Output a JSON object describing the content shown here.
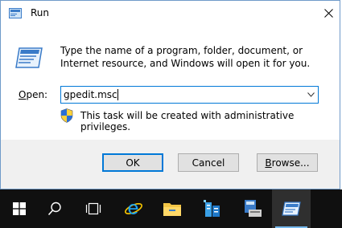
{
  "window": {
    "title": "Run",
    "description": "Type the name of a program, folder, document, or Internet resource, and Windows will open it for you.",
    "open_label_prefix": "",
    "open_label_accel": "O",
    "open_label_rest": "pen:",
    "open_value": "gpedit.msc",
    "admin_note": "This task will be created with administrative privileges."
  },
  "buttons": {
    "ok": "OK",
    "cancel": "Cancel",
    "browse_prefix": "",
    "browse_accel": "B",
    "browse_rest": "rowse..."
  },
  "taskbar": {
    "items": [
      {
        "icon": "windows-start-icon"
      },
      {
        "icon": "search-icon"
      },
      {
        "icon": "task-view-icon"
      },
      {
        "icon": "internet-explorer-icon"
      },
      {
        "icon": "file-explorer-icon"
      },
      {
        "icon": "server-manager-icon"
      },
      {
        "icon": "powershell-icon"
      },
      {
        "icon": "run-icon"
      }
    ]
  },
  "colors": {
    "accent": "#0078d7",
    "taskbar": "#101010",
    "dialog_bg": "#f0f0f0"
  }
}
